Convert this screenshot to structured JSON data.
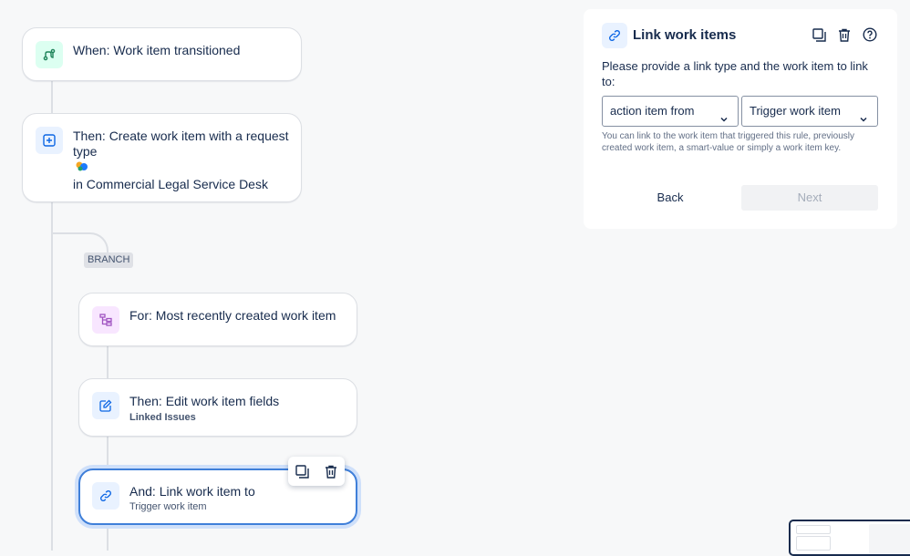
{
  "flow": {
    "trigger": {
      "title": "When: Work item transitioned",
      "icon": "route-icon"
    },
    "create": {
      "title_line1": "Then: Create work item with a request",
      "title_line2": "type",
      "project": "in Commercial Legal Service Desk",
      "icon": "plus-square-icon"
    },
    "branch_label": "BRANCH",
    "for_each": {
      "title": "For: Most recently created work item",
      "icon": "hierarchy-icon"
    },
    "edit": {
      "title": "Then: Edit work item fields",
      "subtitle": "Linked Issues",
      "icon": "edit-icon"
    },
    "link": {
      "title": "And: Link work item to",
      "subtitle": "Trigger work item",
      "icon": "link-icon"
    }
  },
  "panel": {
    "title": "Link work items",
    "prompt": "Please provide a link type and the work item to link to:",
    "link_type_value": "action item from",
    "target_value": "Trigger work item",
    "help": "You can link to the work item that triggered this rule, previously created work item, a smart-value or simply a work item key.",
    "back": "Back",
    "next": "Next"
  }
}
